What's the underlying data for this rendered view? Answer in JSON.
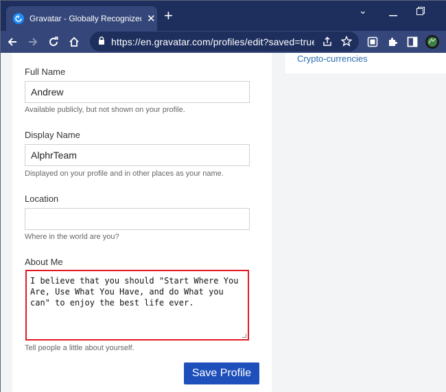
{
  "browser": {
    "tab_title": "Gravatar - Globally Recognized Avatars",
    "url": "https://en.gravatar.com/profiles/edit?saved=true#..."
  },
  "sidebar": {
    "link": "Crypto-currencies"
  },
  "form": {
    "full_name": {
      "label": "Full Name",
      "value": "Andrew",
      "help": "Available publicly, but not shown on your profile."
    },
    "display_name": {
      "label": "Display Name",
      "value": "AlphrTeam",
      "help": "Displayed on your profile and in other places as your name."
    },
    "location": {
      "label": "Location",
      "value": "",
      "help": "Where in the world are you?"
    },
    "about_me": {
      "label": "About Me",
      "value": "I believe that you should \"Start Where You\nAre, Use What You Have, and do What you\ncan\" to enjoy the best life ever.",
      "help": "Tell people a little about yourself."
    },
    "save_label": "Save Profile"
  },
  "colors": {
    "tabstrip": "#1e2f5e",
    "toolbar": "#35477a",
    "highlight_border": "#e2171f",
    "save_button": "#1e4fbb",
    "link": "#2b6cb0"
  }
}
